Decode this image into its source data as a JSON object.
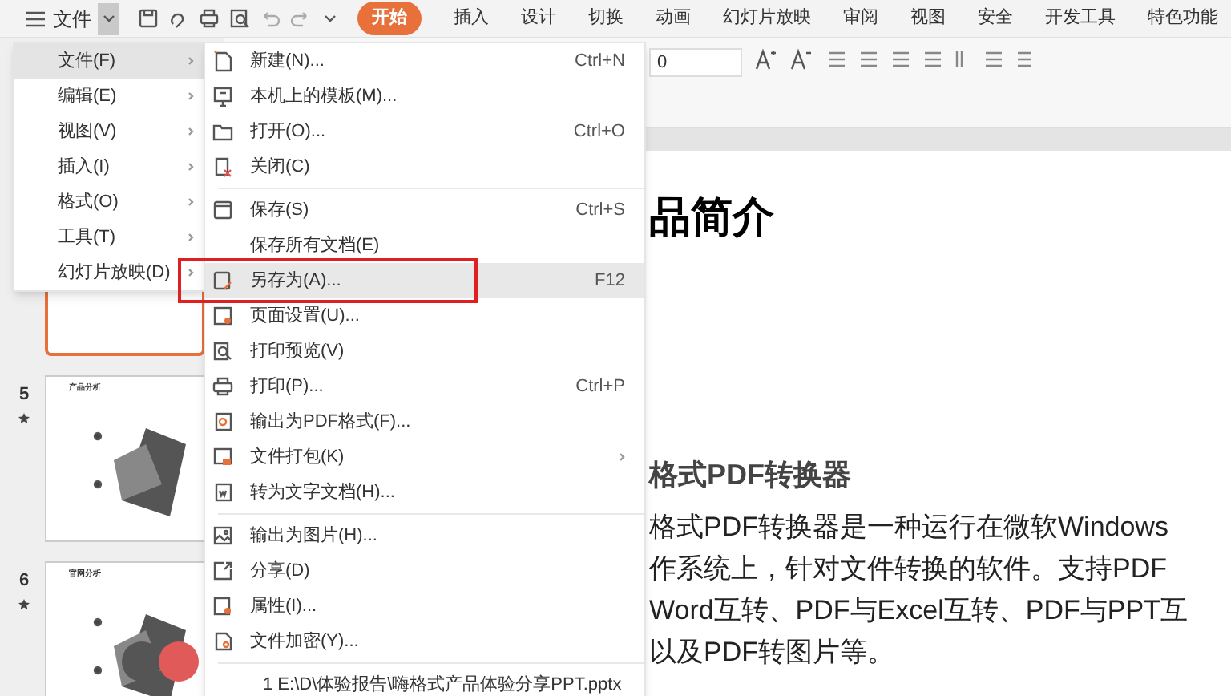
{
  "toolbar": {
    "menu_label": "文件"
  },
  "tabs": [
    {
      "label": "开始",
      "selected": true
    },
    {
      "label": "插入",
      "selected": false
    },
    {
      "label": "设计",
      "selected": false
    },
    {
      "label": "切换",
      "selected": false
    },
    {
      "label": "动画",
      "selected": false
    },
    {
      "label": "幻灯片放映",
      "selected": false
    },
    {
      "label": "审阅",
      "selected": false
    },
    {
      "label": "视图",
      "selected": false
    },
    {
      "label": "安全",
      "selected": false
    },
    {
      "label": "开发工具",
      "selected": false
    },
    {
      "label": "特色功能",
      "selected": false
    }
  ],
  "ribbon": {
    "font_size": "0"
  },
  "main_menu": [
    {
      "label": "文件(F)",
      "selected": true
    },
    {
      "label": "编辑(E)",
      "selected": false
    },
    {
      "label": "视图(V)",
      "selected": false
    },
    {
      "label": "插入(I)",
      "selected": false
    },
    {
      "label": "格式(O)",
      "selected": false
    },
    {
      "label": "工具(T)",
      "selected": false
    },
    {
      "label": "幻灯片放映(D)",
      "selected": false
    }
  ],
  "file_menu": [
    {
      "kind": "item",
      "label": "新建(N)...",
      "shortcut": "Ctrl+N",
      "selected": false
    },
    {
      "kind": "item",
      "label": "本机上的模板(M)...",
      "selected": false
    },
    {
      "kind": "item",
      "label": "打开(O)...",
      "shortcut": "Ctrl+O",
      "selected": false
    },
    {
      "kind": "item",
      "label": "关闭(C)",
      "selected": false
    },
    {
      "kind": "divider"
    },
    {
      "kind": "item",
      "label": "保存(S)",
      "shortcut": "Ctrl+S",
      "selected": false
    },
    {
      "kind": "item",
      "label": "保存所有文档(E)",
      "selected": false
    },
    {
      "kind": "item",
      "label": "另存为(A)...",
      "shortcut": "F12",
      "selected": true
    },
    {
      "kind": "item",
      "label": "页面设置(U)...",
      "selected": false
    },
    {
      "kind": "item",
      "label": "打印预览(V)",
      "selected": false
    },
    {
      "kind": "item",
      "label": "打印(P)...",
      "shortcut": "Ctrl+P",
      "selected": false
    },
    {
      "kind": "item",
      "label": "输出为PDF格式(F)...",
      "selected": false
    },
    {
      "kind": "submenu",
      "label": "文件打包(K)",
      "selected": false
    },
    {
      "kind": "item",
      "label": "转为文字文档(H)...",
      "selected": false
    },
    {
      "kind": "divider"
    },
    {
      "kind": "item",
      "label": "输出为图片(H)...",
      "selected": false
    },
    {
      "kind": "item",
      "label": "分享(D)",
      "selected": false
    },
    {
      "kind": "item",
      "label": "属性(I)...",
      "selected": false
    },
    {
      "kind": "item",
      "label": "文件加密(Y)...",
      "selected": false
    },
    {
      "kind": "divider"
    },
    {
      "kind": "recent",
      "label": "1 E:\\D\\体验报告\\嗨格式产品体验分享PPT.pptx",
      "selected": false
    }
  ],
  "slides": [
    {
      "selected": true
    },
    {
      "number": "5",
      "title": "产品分析",
      "selected": false
    },
    {
      "number": "6",
      "title": "官网分析",
      "selected": false
    }
  ],
  "slide": {
    "title": "品简介",
    "subtitle": "格式PDF转换器",
    "body_lines": [
      "格式PDF转换器是一种运行在微软Windows",
      "作系统上，针对文件转换的软件。支持PDF",
      "Word互转、PDF与Excel互转、PDF与PPT互",
      "以及PDF转图片等。"
    ]
  }
}
